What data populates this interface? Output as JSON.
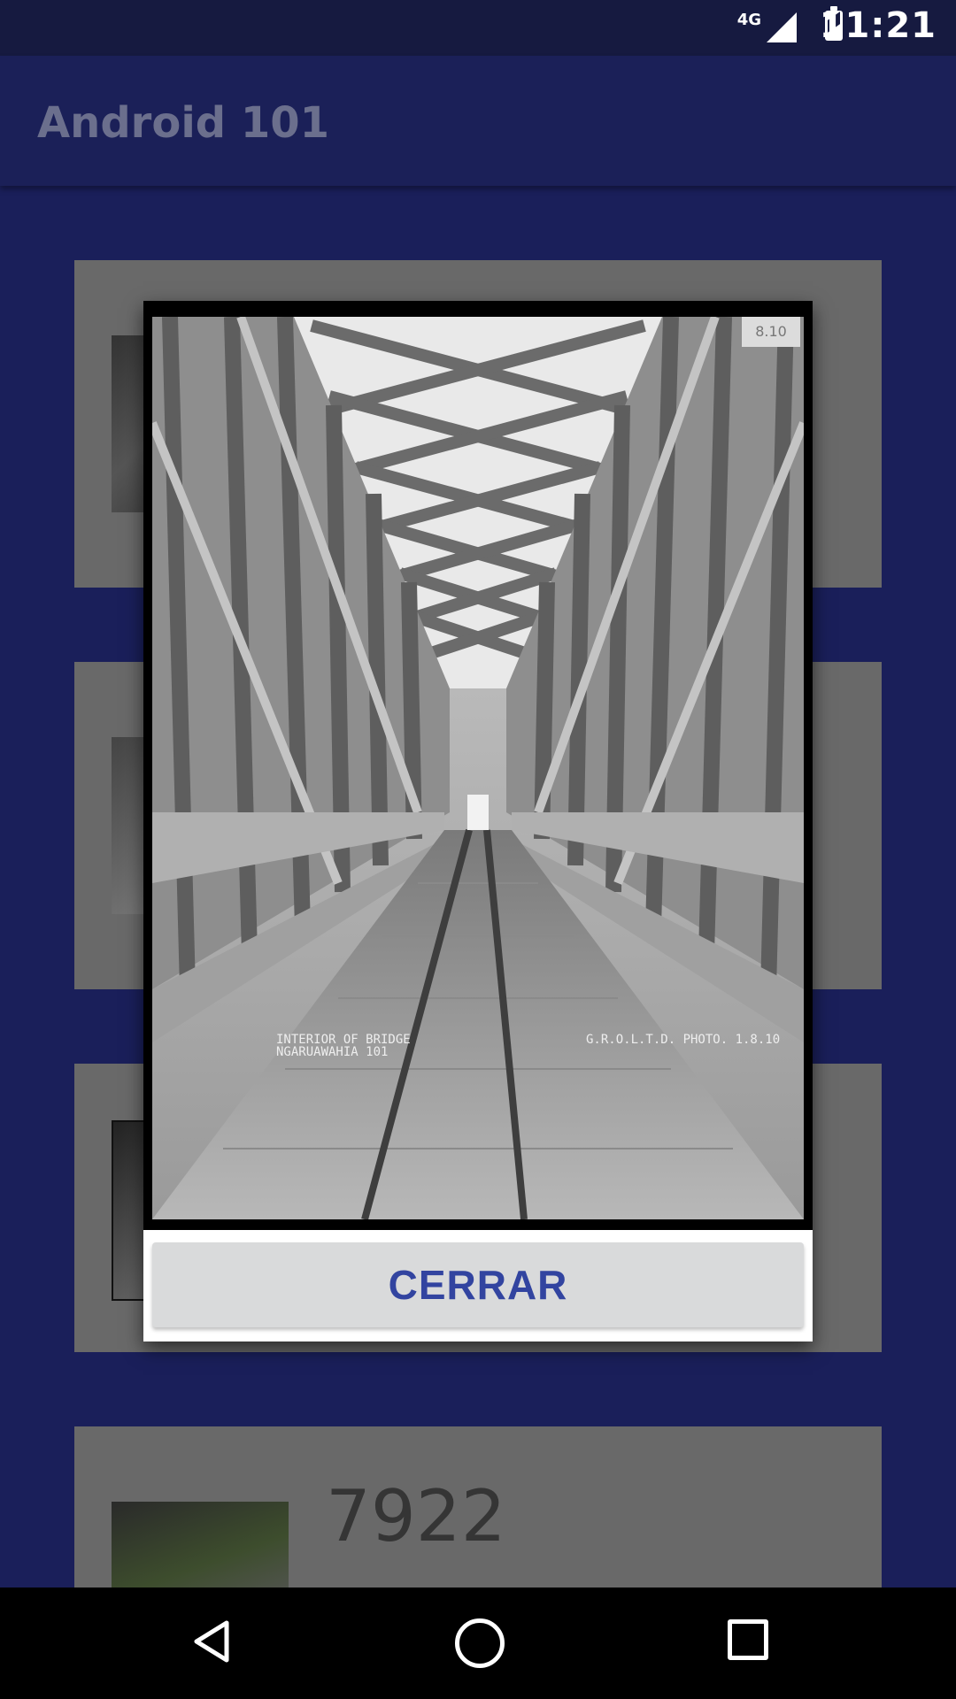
{
  "status_bar": {
    "network": "4G",
    "time": "11:21",
    "icons": [
      "signal-icon",
      "battery-icon"
    ]
  },
  "app_bar": {
    "title": "Android 101"
  },
  "list": {
    "visible_number": "7922"
  },
  "dialog": {
    "image_captions": {
      "left_line1": "INTERIOR OF BRIDGE",
      "left_line2": "NGARUAWAHIA 101",
      "right": "G.R.O.L.T.D. PHOTO. 1.8.10"
    },
    "plate": "8.10",
    "close_label": "CERRAR"
  },
  "navigation": {
    "icons": [
      "back-icon",
      "home-icon",
      "recents-icon"
    ]
  },
  "colors": {
    "background": "#1a1f5a",
    "card": "#696969",
    "button_text": "#3244a0"
  }
}
